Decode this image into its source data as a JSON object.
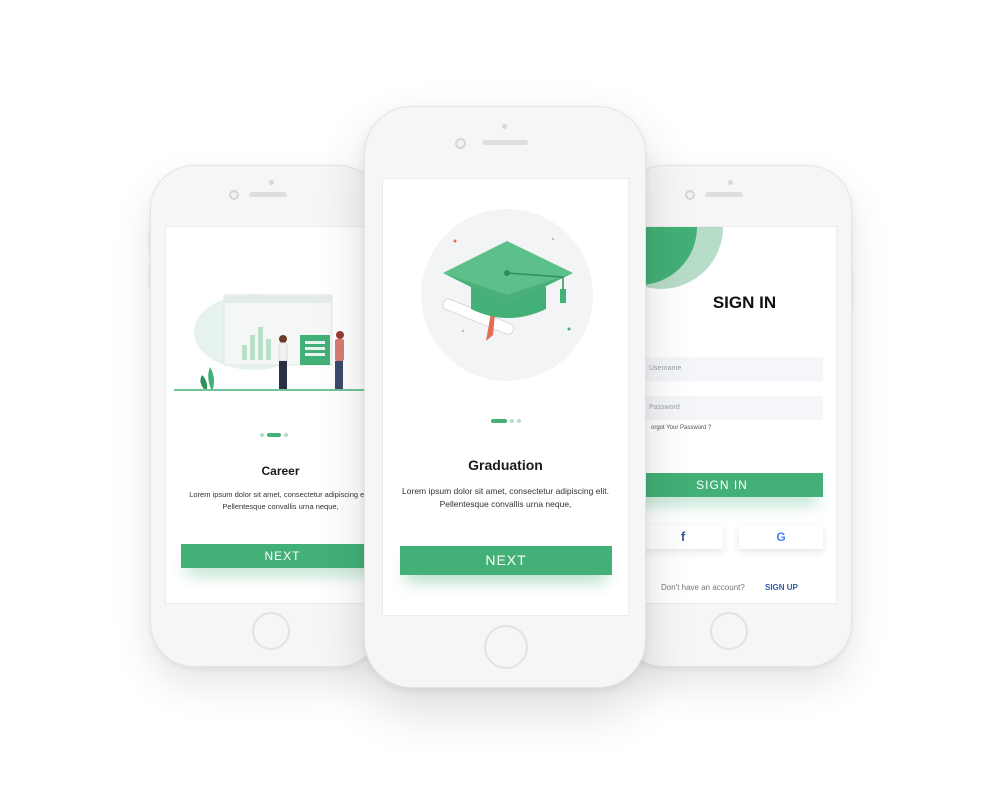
{
  "left_phone": {
    "title": "Career",
    "description_line1": "Lorem ipsum dolor sit amet, consectetur adipiscing elit.",
    "description_line2": "Pellentesque convallis urna neque,",
    "next_label": "NEXT"
  },
  "center_phone": {
    "title": "Graduation",
    "description_line1": "Lorem ipsum dolor sit amet, consectetur adipiscing elit.",
    "description_line2": "Pellentesque convallis urna neque,",
    "next_label": "NEXT"
  },
  "right_phone": {
    "title": "SIGN IN",
    "username_placeholder": "Username",
    "password_placeholder": "Password",
    "forgot_password": "orgot Your Password ?",
    "signin_label": "SIGN IN",
    "facebook_icon_glyph": "f",
    "google_icon_glyph": "G",
    "no_account_text": "Don't have an account?",
    "signup_label": "SIGN UP"
  },
  "colors": {
    "accent": "#43b077",
    "accent_light": "#b7dcc8",
    "facebook": "#3b5998",
    "signup_link": "#2f5fa7"
  }
}
